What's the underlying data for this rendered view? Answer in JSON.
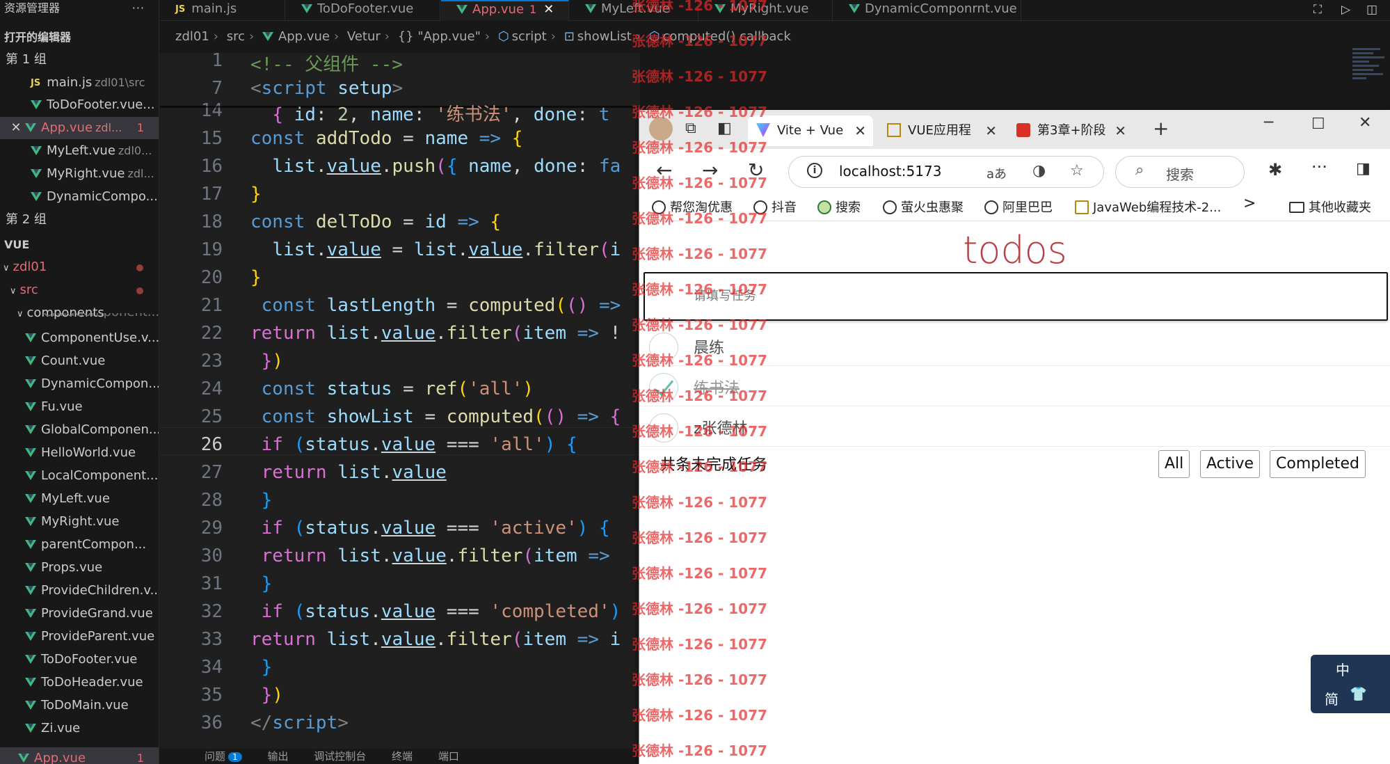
{
  "sidebar": {
    "title": "资源管理器",
    "more": "···",
    "open_editors": "打开的编辑器",
    "group1": "第 1 组",
    "group2": "第 2 组",
    "open_files": [
      {
        "name": "main.js",
        "desc": "zdl01\\src",
        "type": "js"
      },
      {
        "name": "ToDoFooter.vue...",
        "desc": "",
        "type": "vue"
      },
      {
        "name": "App.vue",
        "desc": "zdl...",
        "badge": "1",
        "type": "vue"
      },
      {
        "name": "MyLeft.vue",
        "desc": "zdl0...",
        "type": "vue"
      },
      {
        "name": "MyRight.vue",
        "desc": "zdl...",
        "type": "vue"
      },
      {
        "name": "DynamicCompo...",
        "desc": "",
        "type": "vue"
      }
    ],
    "project_section": "VUE",
    "root_folder": "zdl01",
    "src_folder": "src",
    "components_folder": "components",
    "partial_file": "ChildComponent...",
    "files": [
      "ComponentUse.v...",
      "Count.vue",
      "DynamicCompon...",
      "Fu.vue",
      "GlobalComponen...",
      "HelloWorld.vue",
      "LocalComponent...",
      "MyLeft.vue",
      "MyRight.vue",
      "parentCompon...",
      "Props.vue",
      "ProvideChildren.v...",
      "ProvideGrand.vue",
      "ProvideParent.vue",
      "ToDoFooter.vue",
      "ToDoHeader.vue",
      "ToDoMain.vue",
      "Zi.vue"
    ],
    "app_file": {
      "name": "App.vue",
      "badge": "1"
    }
  },
  "tabs": [
    {
      "label": "main.js",
      "type": "js"
    },
    {
      "label": "ToDoFooter.vue",
      "type": "vue"
    },
    {
      "label": "App.vue",
      "badge": "1",
      "close": "✕",
      "type": "vue"
    },
    {
      "label": "MyLeft.vue",
      "type": "vue"
    },
    {
      "label": "MyRight.vue",
      "type": "vue"
    },
    {
      "label": "DynamicComponrnt.vue",
      "type": "vue"
    }
  ],
  "breadcrumb": [
    "zdl01",
    "src",
    "App.vue",
    "Vetur",
    "{} \"App.vue\"",
    "script",
    "showList",
    "computed() callback"
  ],
  "line_numbers": [
    "1",
    "7",
    "14",
    "15",
    "16",
    "17",
    "18",
    "19",
    "20",
    "21",
    "22",
    "23",
    "24",
    "25",
    "26",
    "27",
    "28",
    "29",
    "30",
    "31",
    "32",
    "33",
    "34",
    "35",
    "36"
  ],
  "panel_tabs": {
    "problems": "问题",
    "problems_count": "1",
    "output": "输出",
    "debug": "调试控制台",
    "terminal": "终端",
    "ports": "端口"
  },
  "browser": {
    "tabs": [
      {
        "label": "Vite + Vue",
        "close": "✕"
      },
      {
        "label": "VUE应用程",
        "close": "✕"
      },
      {
        "label": "第3章+阶段",
        "close": "✕"
      }
    ],
    "new_tab": "+",
    "url": "localhost:5173",
    "search_placeholder": "搜索",
    "bookmarks": [
      "帮您淘优惠",
      "抖音",
      "搜索",
      "萤火虫惠聚",
      "阿里巴巴",
      "JavaWeb编程技术-2..."
    ],
    "bookmarks_more": ">",
    "other_bookmarks": "其他收藏夹"
  },
  "app": {
    "title": "todos",
    "input_placeholder": "请填写任务",
    "todos": [
      {
        "name": "晨练",
        "done": false
      },
      {
        "name": "练书法",
        "done": true
      },
      {
        "name": "z张德林",
        "done": false
      }
    ],
    "remaining_text": "共条未完成任务",
    "filters": [
      "All",
      "Active",
      "Completed"
    ]
  },
  "ime": {
    "mode": "中",
    "layout": "简"
  },
  "watermark": "张德林 -126 - 1077",
  "colors": {
    "accent": "#0078d4",
    "todos_title": "#b83f45",
    "vue_green": "#41b883",
    "watermark": "#e62828"
  }
}
